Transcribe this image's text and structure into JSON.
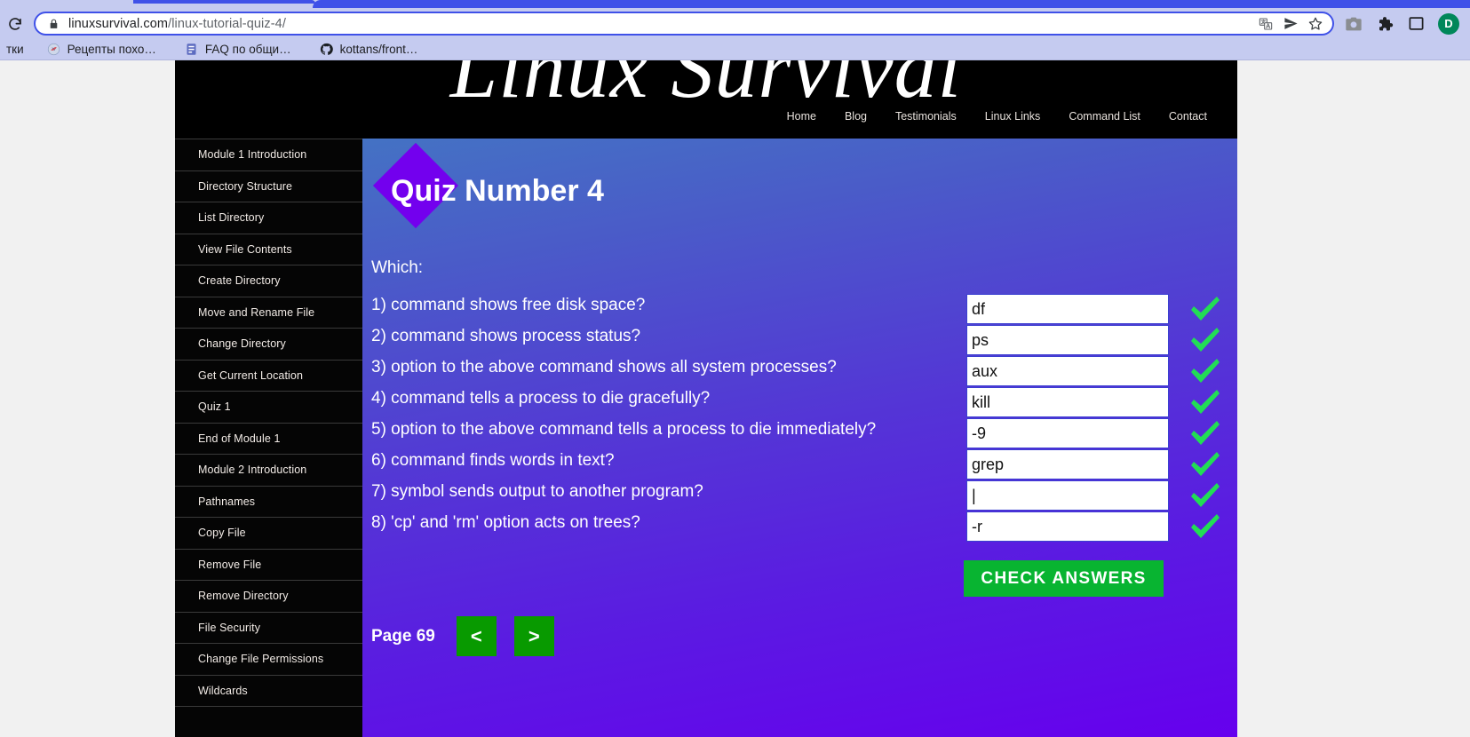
{
  "browser": {
    "reload_icon": "reload-icon",
    "lock_icon": "lock-icon",
    "url_host": "linuxsurvival.com",
    "url_path": "/linux-tutorial-quiz-4/",
    "omnibox_icons": [
      "translate-icon",
      "send-icon",
      "star-icon"
    ],
    "toolbar_icons": [
      "camera-icon",
      "extensions-puzzle-icon",
      "sidepanel-icon"
    ],
    "avatar_initial": "D",
    "bookmarks": [
      {
        "label": "тки",
        "icon": "bookmark-favicon"
      },
      {
        "label": "Рецепты похо…",
        "icon": "recipe-favicon"
      },
      {
        "label": "FAQ по общи…",
        "icon": "doc-favicon"
      },
      {
        "label": "kottans/front…",
        "icon": "github-favicon"
      }
    ]
  },
  "site": {
    "title": "Linux Survival",
    "nav": [
      {
        "label": "Home"
      },
      {
        "label": "Blog"
      },
      {
        "label": "Testimonials"
      },
      {
        "label": "Linux Links"
      },
      {
        "label": "Command List"
      },
      {
        "label": "Contact"
      }
    ],
    "sidebar": [
      {
        "label": "Module 1 Introduction"
      },
      {
        "label": "Directory Structure"
      },
      {
        "label": "List Directory"
      },
      {
        "label": "View File Contents"
      },
      {
        "label": "Create Directory"
      },
      {
        "label": "Move and Rename File"
      },
      {
        "label": "Change Directory"
      },
      {
        "label": "Get Current Location"
      },
      {
        "label": "Quiz 1"
      },
      {
        "label": "End of Module 1"
      },
      {
        "label": "Module 2 Introduction"
      },
      {
        "label": "Pathnames"
      },
      {
        "label": "Copy File"
      },
      {
        "label": "Remove File"
      },
      {
        "label": "Remove Directory"
      },
      {
        "label": "File Security"
      },
      {
        "label": "Change File Permissions"
      },
      {
        "label": "Wildcards"
      }
    ]
  },
  "quiz": {
    "heading": "Quiz Number 4",
    "prompt": "Which:",
    "rows": [
      {
        "question": "1) command shows free disk space?",
        "answer": "df",
        "status": "correct"
      },
      {
        "question": "2) command shows process status?",
        "answer": "ps",
        "status": "correct"
      },
      {
        "question": "3) option to the above command shows all system processes?",
        "answer": "aux",
        "status": "correct"
      },
      {
        "question": "4) command tells a process to die gracefully?",
        "answer": "kill",
        "status": "correct"
      },
      {
        "question": "5) option to the above command tells a process to die immediately?",
        "answer": "-9",
        "status": "correct"
      },
      {
        "question": "6) command finds words in text?",
        "answer": "grep",
        "status": "correct"
      },
      {
        "question": "7) symbol sends output to another program?",
        "answer": "|",
        "status": "correct"
      },
      {
        "question": "8) 'cp' and 'rm' option acts on trees?",
        "answer": "-r",
        "status": "correct"
      }
    ],
    "answer_placeholder": "",
    "check_button": "CHECK ANSWERS",
    "page_label": "Page 69",
    "prev_button": "<",
    "next_button": ">"
  },
  "colors": {
    "accent_purple": "#7300EE",
    "check_green": "#08B431",
    "pager_green": "#089A00",
    "checkmark_green": "#22DD55",
    "gradient_top": "#4472C4",
    "gradient_bottom": "#6600EE",
    "chrome_blue": "#C5CBF0",
    "avatar_green": "#00875A"
  }
}
